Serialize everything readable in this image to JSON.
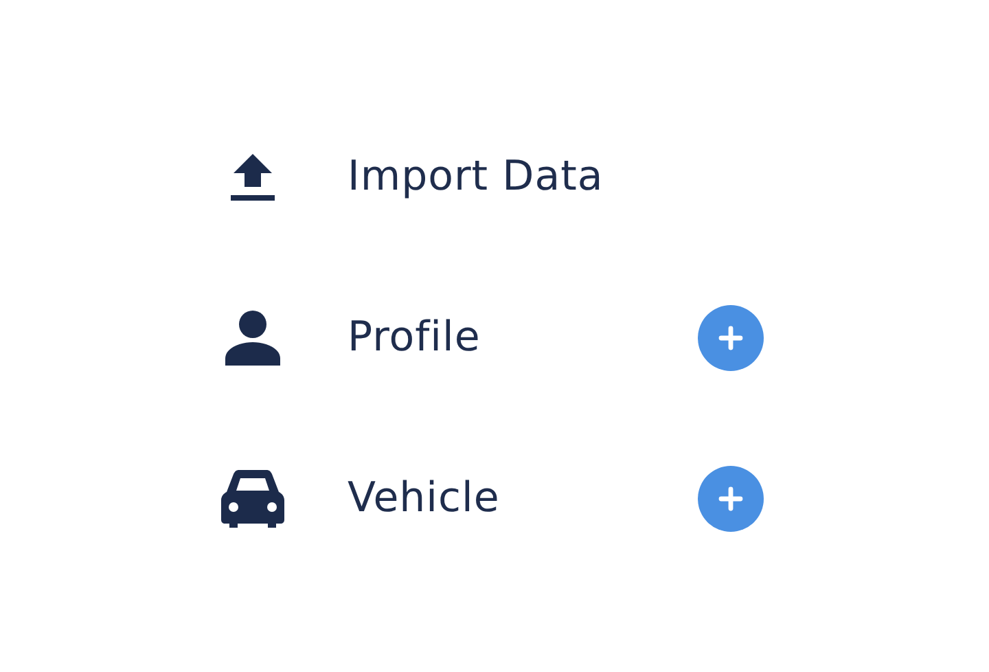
{
  "items": [
    {
      "kind": "upload",
      "label": "Import Data",
      "add_button": false
    },
    {
      "kind": "person",
      "label": "Profile",
      "add_button": true
    },
    {
      "kind": "car",
      "label": "Vehicle",
      "add_button": true
    }
  ]
}
